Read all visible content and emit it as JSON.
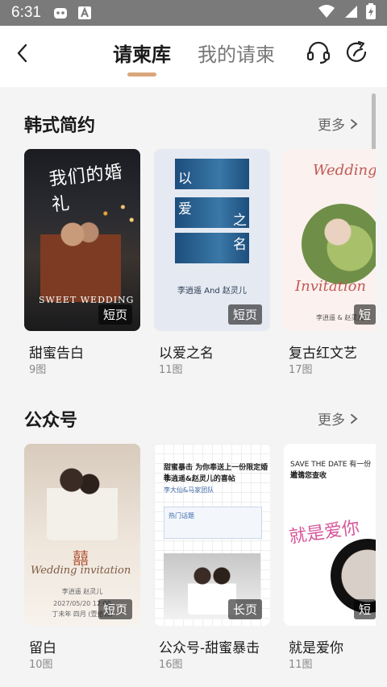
{
  "status_bar": {
    "time": "6:31"
  },
  "header": {
    "tabs": [
      {
        "label": "请柬库",
        "active": true
      },
      {
        "label": "我的请柬",
        "active": false
      }
    ]
  },
  "sections": [
    {
      "title": "韩式简约",
      "more_label": "更多",
      "items": [
        {
          "name": "甜蜜告白",
          "count": "9图",
          "badge": "短页",
          "art_title": "我们的婚礼",
          "art_subtitle": "SWEET WEDDING"
        },
        {
          "name": "以爱之名",
          "count": "11图",
          "badge": "短页",
          "art_chars": [
            "以",
            "爱",
            "之",
            "名"
          ],
          "art_names": "李逍遥 And 赵灵儿"
        },
        {
          "name": "复古红文艺",
          "count": "17图",
          "badge": "短",
          "art_script_top": "Wedding",
          "art_script_bottom": "Invitation",
          "art_names": "李逍遥 & 赵灵儿"
        }
      ]
    },
    {
      "title": "公众号",
      "more_label": "更多",
      "items": [
        {
          "name": "留白",
          "count": "10图",
          "badge": "短页",
          "art_char": "囍",
          "art_script": "Wedding invitation",
          "art_names": "李逍遥  赵灵儿",
          "art_date": "2027/05/20 12:00",
          "art_place": "丁未年 四月 (壹拾日)"
        },
        {
          "name": "公众号-甜蜜暴击",
          "count": "16图",
          "badge": "长页",
          "art_line1": "甜蜜暴击 为你奉送上一份限定婚礼",
          "art_line2": "李逍遥&赵灵儿的喜帖",
          "art_line3": "李大仙&马家团队",
          "art_line4": "热门话题"
        },
        {
          "name": "就是爱你",
          "count": "11图",
          "badge": "短",
          "art_line1": "SAVE THE DATE 有一份婚礼",
          "art_line2": "邀请您查收",
          "art_pink": "就是爱你"
        }
      ]
    }
  ],
  "colors": {
    "accent": "#d9a77b",
    "status_bar": "#7a7a7a"
  },
  "icons": {
    "back": "chevron-left-icon",
    "headphones": "headphones-icon",
    "share": "share-icon",
    "more": "chevron-right-icon"
  }
}
